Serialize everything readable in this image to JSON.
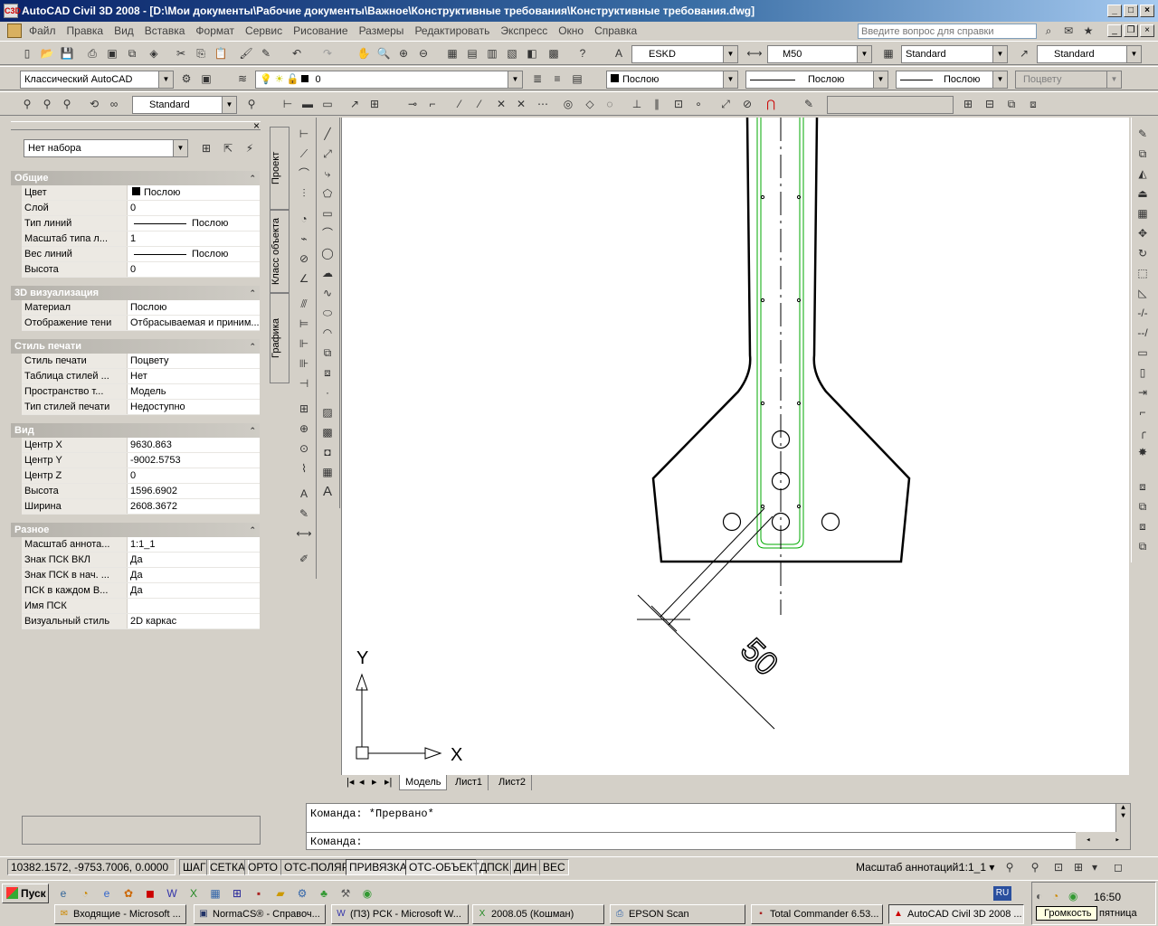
{
  "window": {
    "title": "AutoCAD Civil 3D 2008 - [D:\\Мои документы\\Рабочие документы\\Важное\\Конструктивные требования\\Конструктивные требования.dwg]",
    "app_icon": "C3D"
  },
  "menu": {
    "items": [
      "Файл",
      "Правка",
      "Вид",
      "Вставка",
      "Формат",
      "Сервис",
      "Рисование",
      "Размеры",
      "Редактировать",
      "Экспресс",
      "Окно",
      "Справка"
    ],
    "help_placeholder": "Введите вопрос для справки"
  },
  "toolbar1": {
    "textstyle": "ESKD",
    "dimstyle": "M50",
    "tablestyle": "Standard",
    "mleaderstyle": "Standard"
  },
  "toolbar2": {
    "workspace": "Классический AutoCAD",
    "layer": "0",
    "color": "Послою",
    "linetype": "Послою",
    "lineweight": "Послою",
    "plotstyle": "Поцвету"
  },
  "toolbar3": {
    "style": "Standard"
  },
  "properties": {
    "selection": "Нет набора",
    "tabs": [
      "Проект",
      "Класс объекта",
      "Графика"
    ],
    "sections": [
      {
        "title": "Общие",
        "rows": [
          {
            "label": "Цвет",
            "value": "Послою"
          },
          {
            "label": "Слой",
            "value": "0"
          },
          {
            "label": "Тип линий",
            "value": "Послою"
          },
          {
            "label": "Масштаб типа л...",
            "value": "1"
          },
          {
            "label": "Вес линий",
            "value": "Послою"
          },
          {
            "label": "Высота",
            "value": "0"
          }
        ]
      },
      {
        "title": "3D визуализация",
        "rows": [
          {
            "label": "Материал",
            "value": "Послою"
          },
          {
            "label": "Отображение тени",
            "value": "Отбрасываемая и приним..."
          }
        ]
      },
      {
        "title": "Стиль печати",
        "rows": [
          {
            "label": "Стиль печати",
            "value": "Поцвету"
          },
          {
            "label": "Таблица стилей ...",
            "value": "Нет"
          },
          {
            "label": "Пространство т...",
            "value": "Модель"
          },
          {
            "label": "Тип стилей печати",
            "value": "Недоступно"
          }
        ]
      },
      {
        "title": "Вид",
        "rows": [
          {
            "label": "Центр X",
            "value": "9630.863"
          },
          {
            "label": "Центр Y",
            "value": "-9002.5753"
          },
          {
            "label": "Центр Z",
            "value": "0"
          },
          {
            "label": "Высота",
            "value": "1596.6902"
          },
          {
            "label": "Ширина",
            "value": "2608.3672"
          }
        ]
      },
      {
        "title": "Разное",
        "rows": [
          {
            "label": "Масштаб аннота...",
            "value": "1:1_1"
          },
          {
            "label": "Знак ПСК ВКЛ",
            "value": "Да"
          },
          {
            "label": "Знак ПСК в нач. ...",
            "value": "Да"
          },
          {
            "label": "ПСК в каждом В...",
            "value": "Да"
          },
          {
            "label": "Имя ПСК",
            "value": ""
          },
          {
            "label": "Визуальный стиль",
            "value": "2D каркас"
          }
        ]
      }
    ]
  },
  "drawing": {
    "dimension_text": "50",
    "ucs_x": "X",
    "ucs_y": "Y",
    "colors": {
      "geometry": "#000000",
      "rebar": "#00aa00",
      "background": "#ffffff"
    }
  },
  "layout_tabs": [
    "Модель",
    "Лист1",
    "Лист2"
  ],
  "command": {
    "history": "Команда: *Прервано*",
    "prompt": "Команда:"
  },
  "status": {
    "coords": "10382.1572, -9753.7006, 0.0000",
    "modes": [
      "ШАГ",
      "СЕТКА",
      "ОРТО",
      "ОТС-ПОЛЯР",
      "ПРИВЯЗКА",
      "ОТС-ОБЪЕКТ",
      "ДПСК",
      "ДИН",
      "ВЕС"
    ],
    "annotation_scale_label": "Масштаб аннотаций:",
    "annotation_scale": "1:1_1"
  },
  "taskbar": {
    "start": "Пуск",
    "tasks": [
      {
        "label": "Входящие - Microsoft ...",
        "icon": "outlook-icon"
      },
      {
        "label": "NormaCS® - Справоч...",
        "icon": "normacs-icon"
      },
      {
        "label": "(ПЗ) РСК - Microsoft W...",
        "icon": "word-icon"
      },
      {
        "label": "2008.05 (Кошман)",
        "icon": "excel-icon"
      },
      {
        "label": "EPSON Scan",
        "icon": "scanner-icon"
      },
      {
        "label": "Total Commander 6.53...",
        "icon": "floppy-icon"
      },
      {
        "label": "AutoCAD Civil 3D 2008 ...",
        "icon": "autocad-icon"
      }
    ],
    "lang": "RU",
    "clock": "16:50",
    "tooltip": "Громкость",
    "day": "пятница"
  }
}
